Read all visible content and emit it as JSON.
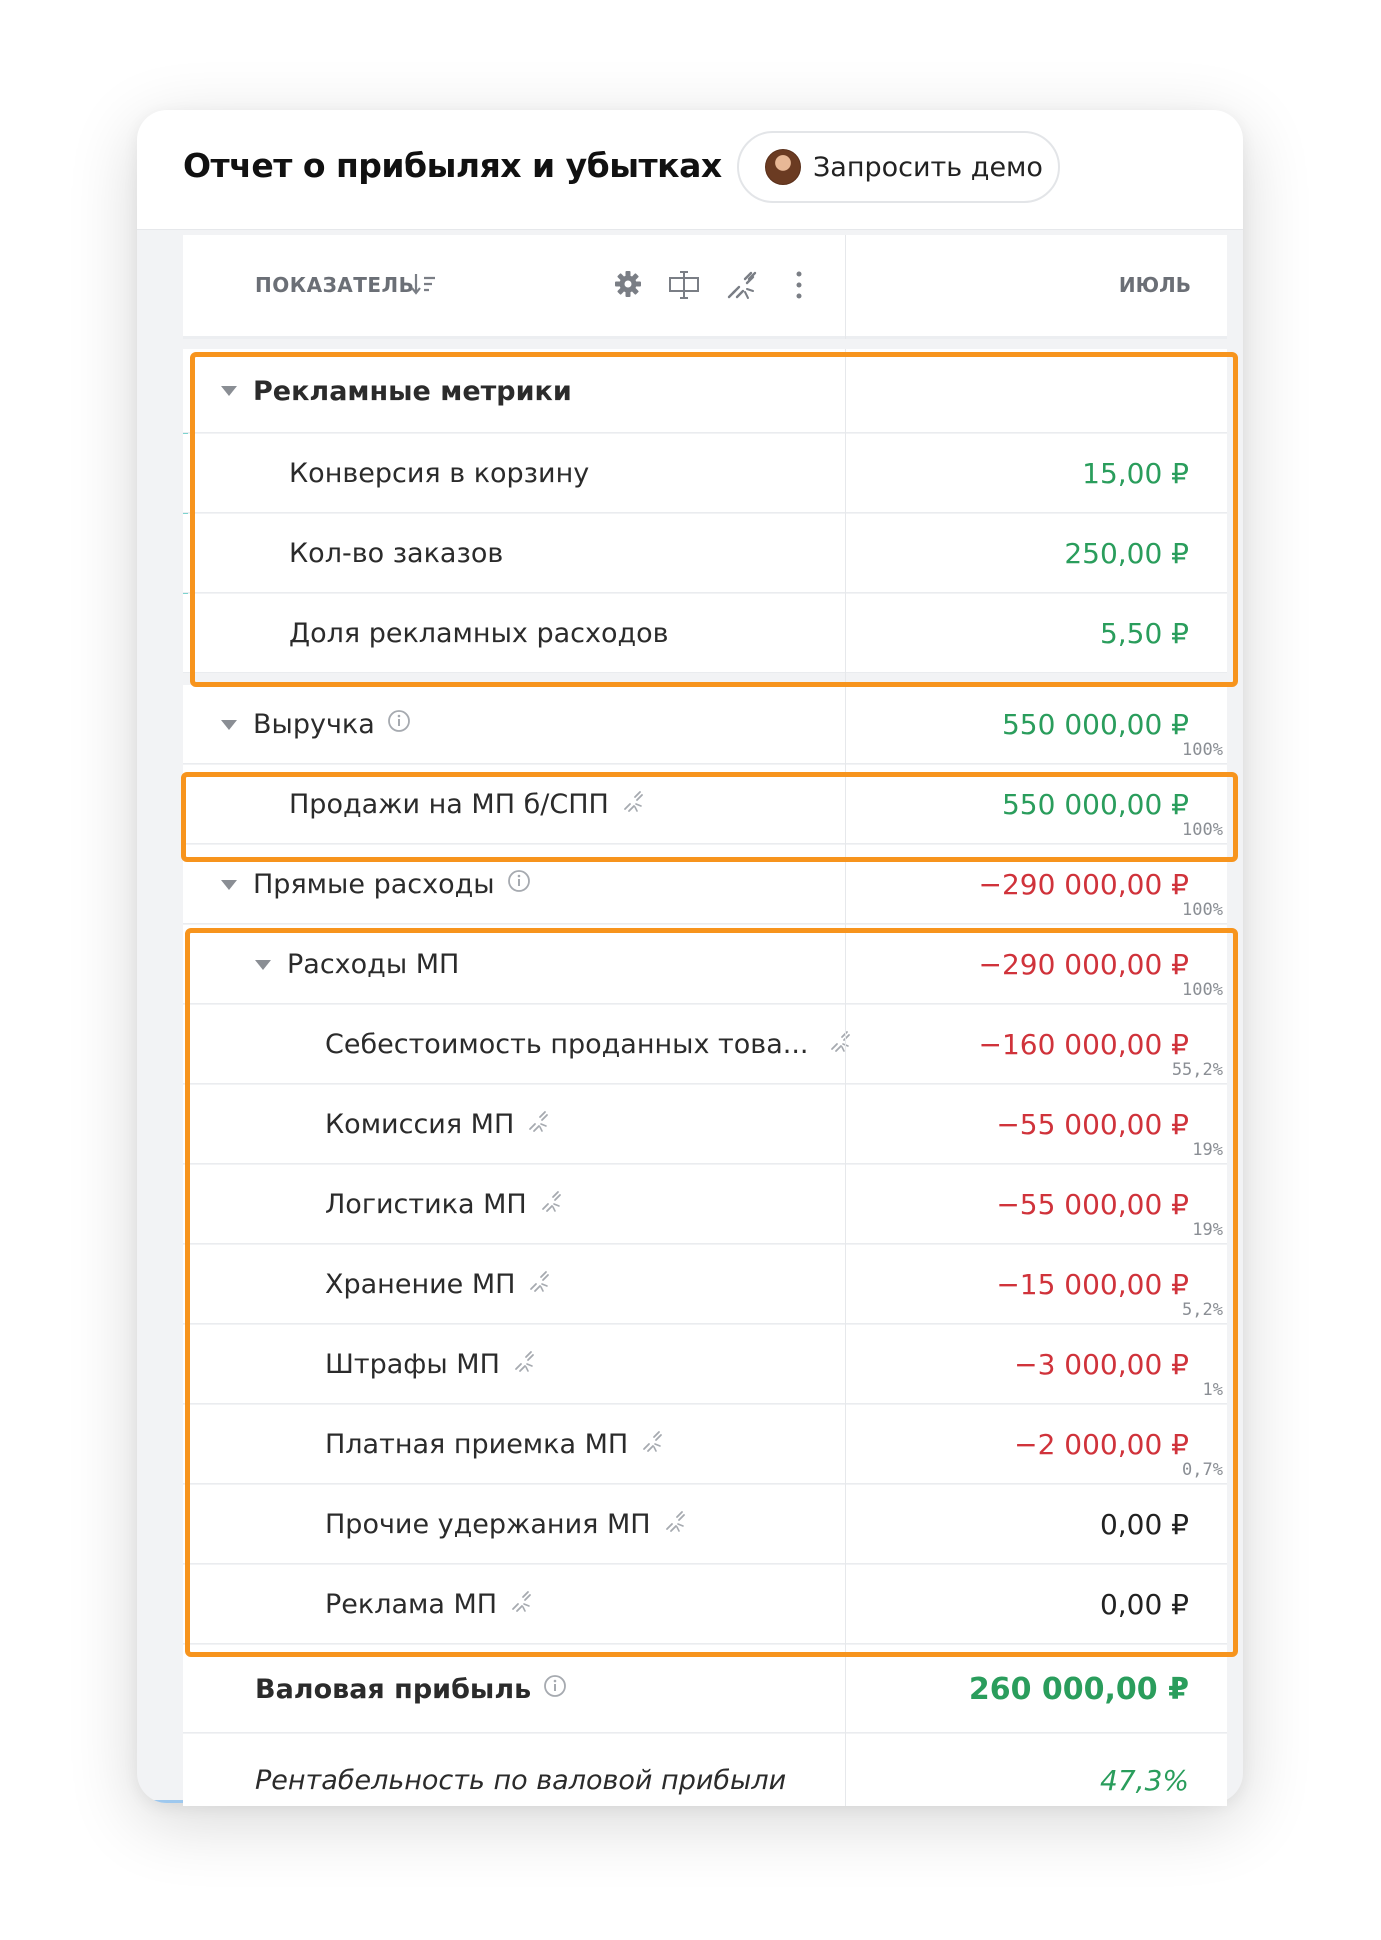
{
  "header": {
    "title": "Отчет о прибылях и убытках",
    "demo_button": "Запросить демо"
  },
  "table_header": {
    "indicator_label": "ПОКАЗАТЕЛЬ",
    "month_label": "ИЮЛЬ",
    "icons": [
      "sort-icon",
      "gear-icon",
      "columns-icon",
      "unlink-icon",
      "more-vertical-icon"
    ]
  },
  "rows": [
    {
      "label": "Рекламные метрики",
      "value": "",
      "pct": ""
    },
    {
      "label": "Конверсия в корзину",
      "value": "15,00 ₽",
      "pct": ""
    },
    {
      "label": "Кол-во заказов",
      "value": "250,00 ₽",
      "pct": ""
    },
    {
      "label": "Доля рекламных расходов",
      "value": "5,50 ₽",
      "pct": ""
    },
    {
      "label": "Выручка",
      "value": "550 000,00 ₽",
      "pct": "100%"
    },
    {
      "label": "Продажи на МП б/СПП",
      "value": "550 000,00 ₽",
      "pct": "100%"
    },
    {
      "label": "Прямые расходы",
      "value": "−290 000,00 ₽",
      "pct": "100%"
    },
    {
      "label": "Расходы МП",
      "value": "−290 000,00 ₽",
      "pct": "100%"
    },
    {
      "label": "Себестоимость проданных това...",
      "value": "−160 000,00 ₽",
      "pct": "55,2%"
    },
    {
      "label": "Комиссия МП",
      "value": "−55 000,00 ₽",
      "pct": "19%"
    },
    {
      "label": "Логистика МП",
      "value": "−55 000,00 ₽",
      "pct": "19%"
    },
    {
      "label": "Хранение МП",
      "value": "−15 000,00 ₽",
      "pct": "5,2%"
    },
    {
      "label": "Штрафы МП",
      "value": "−3 000,00 ₽",
      "pct": "1%"
    },
    {
      "label": "Платная приемка МП",
      "value": "−2 000,00 ₽",
      "pct": "0,7%"
    },
    {
      "label": "Прочие удержания МП",
      "value": "0,00 ₽",
      "pct": ""
    },
    {
      "label": "Реклама МП",
      "value": "0,00 ₽",
      "pct": ""
    },
    {
      "label": "Валовая прибыль",
      "value": "260 000,00 ₽",
      "pct": ""
    },
    {
      "label": "Рентабельность по валовой прибыли",
      "value": "47,3%",
      "pct": ""
    }
  ],
  "colors": {
    "positive": "#2a9d5c",
    "negative": "#d0333b",
    "highlight": "#f7941d",
    "group_accent": "#7dd3cf"
  }
}
